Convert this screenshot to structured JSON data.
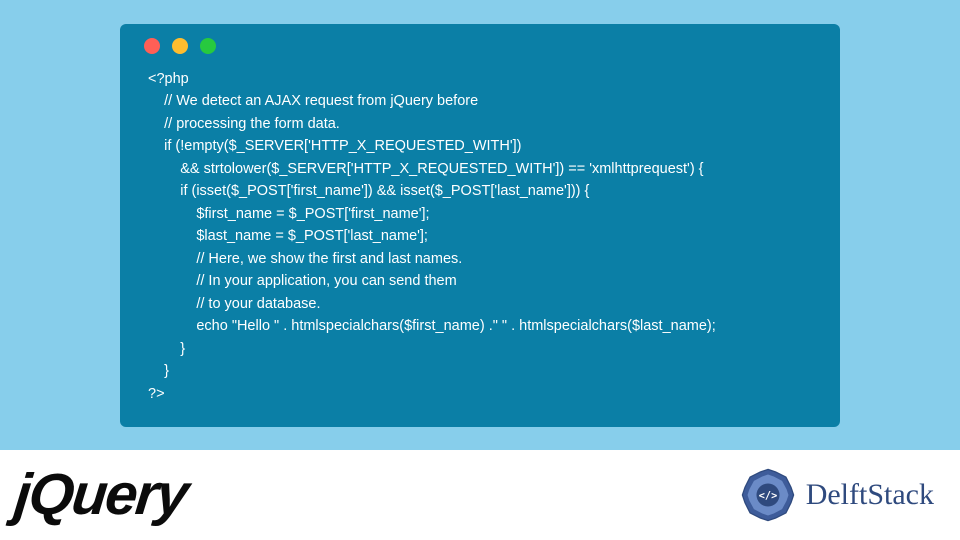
{
  "code": {
    "line1": "<?php",
    "line2": "    // We detect an AJAX request from jQuery before",
    "line3": "    // processing the form data.",
    "line4": "    if (!empty($_SERVER['HTTP_X_REQUESTED_WITH'])",
    "line5": "        && strtolower($_SERVER['HTTP_X_REQUESTED_WITH']) == 'xmlhttprequest') {",
    "line6": "        if (isset($_POST['first_name']) && isset($_POST['last_name'])) {",
    "line7": "            $first_name = $_POST['first_name'];",
    "line8": "            $last_name = $_POST['last_name'];",
    "line9": "            // Here, we show the first and last names.",
    "line10": "            // In your application, you can send them",
    "line11": "            // to your database.",
    "line12": "            echo \"Hello \" . htmlspecialchars($first_name) .\" \" . htmlspecialchars($last_name);",
    "line13": "        }",
    "line14": "    }",
    "line15": "?>"
  },
  "logos": {
    "jquery": "jQuery",
    "delft": "DelftStack"
  }
}
